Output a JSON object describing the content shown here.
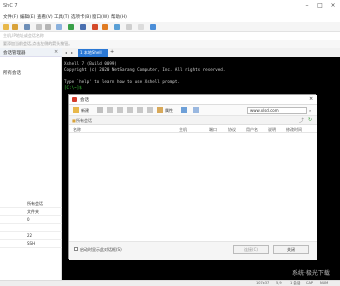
{
  "window": {
    "title": "ShC 7"
  },
  "menus": [
    "文件(F)",
    "编辑(E)",
    "查看(V)",
    "工具(T)",
    "选项卡(B)",
    "窗口(W)",
    "帮助(H)"
  ],
  "addressbar": {
    "placeholder": "主机,IP地址或会话名称"
  },
  "hintbar": {
    "text": "要添加当前会话,点击左侧的箭头按钮。"
  },
  "sidepanel": {
    "title": "会话管理器",
    "root_item": "所有会话",
    "properties": [
      {
        "name": "",
        "value": "所有会话"
      },
      {
        "name": "",
        "value": "文件夹"
      },
      {
        "name": "",
        "value": "0"
      },
      {
        "name": "",
        "value": ""
      },
      {
        "name": "",
        "value": "22"
      },
      {
        "name": "",
        "value": "SSH"
      }
    ]
  },
  "tabs": {
    "active_label": "1 本地Shell",
    "add_label": "+"
  },
  "terminal": {
    "lines": [
      "Xshell 7 (Build 0099)",
      "Copyright (c) 2020 NetSarang Computer, Inc. All rights reserved.",
      "",
      "Type `help' to learn how to use Xshell prompt.",
      "[C:\\~]$ "
    ]
  },
  "dialog": {
    "title": "会话",
    "close_glyph": "×",
    "toolbar": {
      "new_label": "新建",
      "properties_label": "属性"
    },
    "search_value": "www.xlsd.com",
    "folder_label": "所有会话",
    "columns": [
      "名称",
      "主机",
      "端口",
      "协议",
      "用户名",
      "说明",
      "修改时间"
    ],
    "startup_checkbox_label": "启动时显示此对话框(S)",
    "connect_button": "连接(C)",
    "close_button": "关闭"
  },
  "statusbar": {
    "cols_rows": "107x37",
    "cursor": "5,9",
    "sessions": "1 会话",
    "cap": "CAP",
    "num": "NUM"
  },
  "watermark": "系统·极光下载"
}
